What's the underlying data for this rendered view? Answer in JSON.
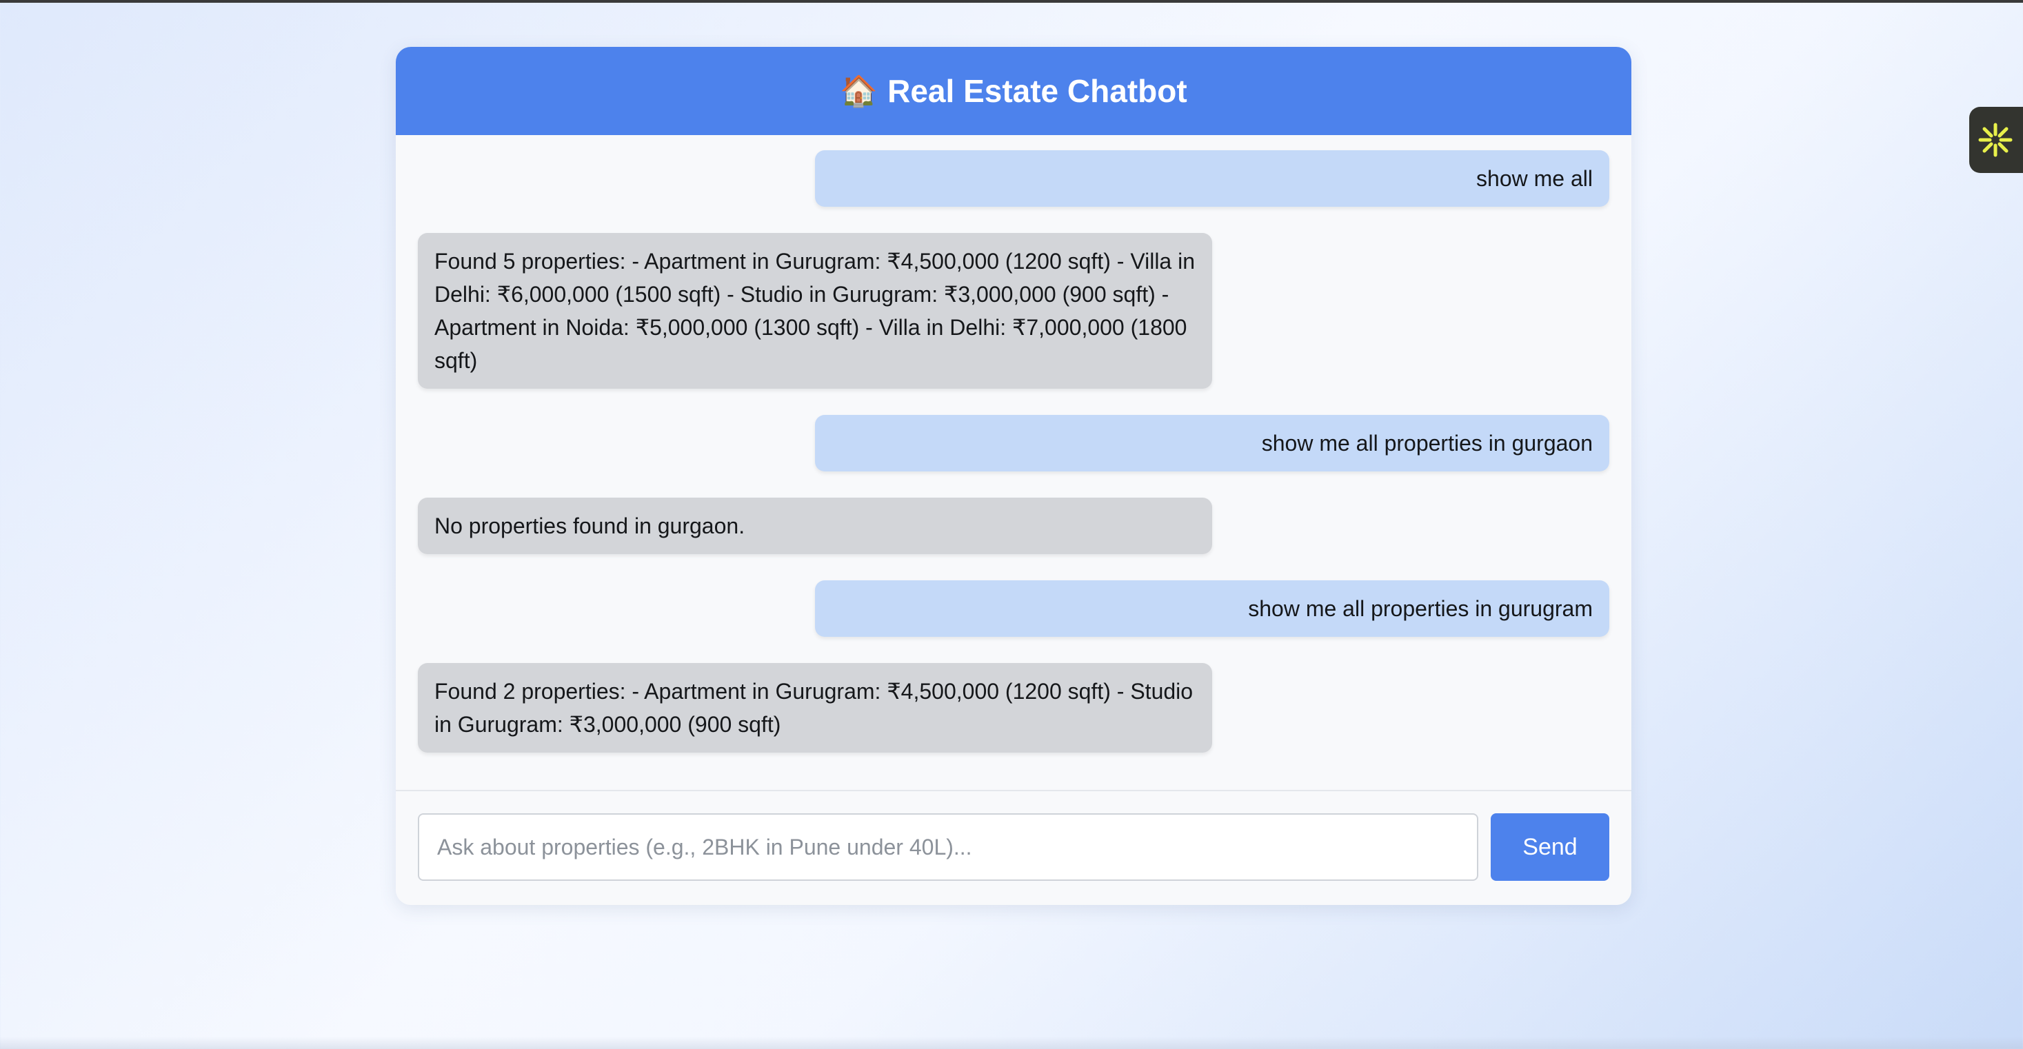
{
  "header": {
    "icon": "house-icon",
    "title": "Real Estate Chatbot"
  },
  "messages": [
    {
      "role": "user",
      "text": "show me all"
    },
    {
      "role": "bot",
      "text": "Found 5 properties: - Apartment in Gurugram: ₹4,500,000 (1200 sqft) - Villa in Delhi: ₹6,000,000 (1500 sqft) - Studio in Gurugram: ₹3,000,000 (900 sqft) - Apartment in Noida: ₹5,000,000 (1300 sqft) - Villa in Delhi: ₹7,000,000 (1800 sqft)"
    },
    {
      "role": "user",
      "text": "show me all properties in gurgaon"
    },
    {
      "role": "bot",
      "text": "No properties found in gurgaon."
    },
    {
      "role": "user",
      "text": "show me all properties in gurugram"
    },
    {
      "role": "bot",
      "text": "Found 2 properties: - Apartment in Gurugram: ₹4,500,000 (1200 sqft) - Studio in Gurugram: ₹3,000,000 (900 sqft)"
    }
  ],
  "input": {
    "placeholder": "Ask about properties (e.g., 2BHK in Pune under 40L)...",
    "value": ""
  },
  "send_button": {
    "label": "Send"
  },
  "side_widget": {
    "icon": "asterisk-sparkle-icon"
  },
  "colors": {
    "header_bg": "#4d82ec",
    "user_bubble": "#c4d9f8",
    "bot_bubble": "#d3d5d9",
    "send_button": "#4d82ec",
    "widget_accent": "#e8f04a"
  }
}
